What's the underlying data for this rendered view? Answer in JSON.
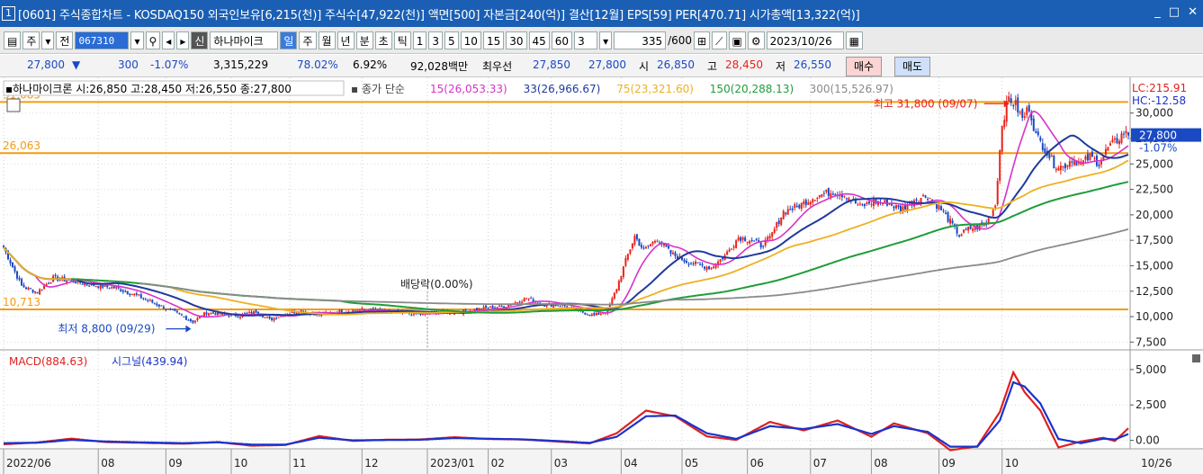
{
  "window": {
    "number": "1",
    "title": "[0601] 주식종합차트 - KOSDAQ150 외국인보유[6,215(천)] 주식수[47,922(천)] 액면[500] 자본금[240(억)] 결산[12월] EPS[59] PER[470.71] 시가총액[13,322(억)]",
    "controls": [
      "_",
      "□",
      "✕"
    ]
  },
  "toolbar": {
    "period_week": "주",
    "prefix": "전",
    "code": "067310",
    "badge": "신",
    "name": "하나마이크",
    "periods": [
      "일",
      "주",
      "월",
      "년",
      "분",
      "초",
      "틱"
    ],
    "active_period": "일",
    "intervals": [
      "1",
      "3",
      "5",
      "10",
      "15",
      "30",
      "45",
      "60"
    ],
    "count_select": "3",
    "bar_count": "335",
    "bar_total": "/600",
    "date": "2023/10/26"
  },
  "quote": {
    "price": "27,800",
    "arrow": "▼",
    "change": "300",
    "change_rate": "-1.07%",
    "volume": "3,315,229",
    "vol_ratio": "78.02%",
    "turnover": "6.92%",
    "amount": "92,028백만",
    "best_label": "최우선",
    "ask": "27,850",
    "bid": "27,800",
    "open_label": "시",
    "open": "26,850",
    "high_label": "고",
    "high": "28,450",
    "low_label": "저",
    "low": "26,550",
    "buy_label": "매수",
    "sell_label": "매도"
  },
  "colors": {
    "up": "#e8231b",
    "down": "#1a49c4",
    "hline": "#f39c12",
    "ma15": "#d633c8",
    "ma33": "#1f3a9e",
    "ma75": "#eeb021",
    "ma150": "#1f9d3a",
    "ma300": "#8a8a8a",
    "macd": "#e02020",
    "signal": "#1a33cc"
  },
  "chart_data": [
    {
      "type": "line",
      "subtype": "candlestick",
      "legend_stock": "하나마이크론 시:26,850 고:28,450 저:26,550 종:27,800",
      "legend_ma_prefix": "종가 단순",
      "series": [
        {
          "name": "15(26,053.33)",
          "period": 15
        },
        {
          "name": "33(26,966.67)",
          "period": 33
        },
        {
          "name": "75(23,321.60)",
          "period": 75
        },
        {
          "name": "150(20,288.13)",
          "period": 150
        },
        {
          "name": "300(15,526.97)",
          "period": 300
        }
      ],
      "close_anchors": [
        [
          0,
          16800
        ],
        [
          8,
          13000
        ],
        [
          15,
          12400
        ],
        [
          22,
          13800
        ],
        [
          30,
          13500
        ],
        [
          40,
          13100
        ],
        [
          50,
          12800
        ],
        [
          60,
          12000
        ],
        [
          68,
          11200
        ],
        [
          76,
          10400
        ],
        [
          84,
          9500
        ],
        [
          90,
          10400
        ],
        [
          98,
          10200
        ],
        [
          105,
          10100
        ],
        [
          112,
          10500
        ],
        [
          118,
          9700
        ],
        [
          124,
          10200
        ],
        [
          132,
          10600
        ],
        [
          140,
          10200
        ],
        [
          150,
          10500
        ],
        [
          160,
          10700
        ],
        [
          172,
          10500
        ],
        [
          180,
          10300
        ],
        [
          186,
          10200
        ],
        [
          194,
          10500
        ],
        [
          200,
          10400
        ],
        [
          206,
          10600
        ],
        [
          212,
          10800
        ],
        [
          222,
          11000
        ],
        [
          232,
          11800
        ],
        [
          240,
          11200
        ],
        [
          248,
          11100
        ],
        [
          256,
          10500
        ],
        [
          262,
          10100
        ],
        [
          268,
          10600
        ],
        [
          272,
          12800
        ],
        [
          276,
          15500
        ],
        [
          280,
          17900
        ],
        [
          284,
          16500
        ],
        [
          290,
          17700
        ],
        [
          296,
          16200
        ],
        [
          302,
          15500
        ],
        [
          308,
          15100
        ],
        [
          314,
          14800
        ],
        [
          320,
          16000
        ],
        [
          326,
          17800
        ],
        [
          332,
          17500
        ],
        [
          336,
          17000
        ],
        [
          340,
          17700
        ],
        [
          346,
          20300
        ],
        [
          352,
          20800
        ],
        [
          360,
          21800
        ],
        [
          368,
          22300
        ],
        [
          374,
          21900
        ],
        [
          380,
          20800
        ],
        [
          386,
          21300
        ],
        [
          392,
          21200
        ],
        [
          398,
          20500
        ],
        [
          404,
          21500
        ],
        [
          410,
          21900
        ],
        [
          416,
          20500
        ],
        [
          420,
          19300
        ],
        [
          424,
          18000
        ],
        [
          428,
          18600
        ],
        [
          432,
          18800
        ],
        [
          436,
          19100
        ],
        [
          440,
          21000
        ],
        [
          443,
          29000
        ],
        [
          446,
          31500
        ],
        [
          449,
          30800
        ],
        [
          452,
          29400
        ],
        [
          455,
          30600
        ],
        [
          458,
          27800
        ],
        [
          462,
          26500
        ],
        [
          466,
          25000
        ],
        [
          470,
          24700
        ],
        [
          474,
          25500
        ],
        [
          478,
          25000
        ],
        [
          482,
          25700
        ],
        [
          486,
          25100
        ],
        [
          490,
          26600
        ],
        [
          494,
          27300
        ],
        [
          497,
          28100
        ],
        [
          499,
          27800
        ]
      ],
      "markers": [
        {
          "label": "최고 31,800 (09/07)",
          "value": 31800,
          "bar": 447
        },
        {
          "label": "최저 8,800 (09/29)",
          "value": 8800,
          "bar": 84
        },
        {
          "label": "배당락(0.00%)",
          "bar": 196
        }
      ],
      "hlines": [
        {
          "label": "31,085",
          "value": 31085
        },
        {
          "label": "26,063",
          "value": 26063
        },
        {
          "label": "10,713",
          "value": 10713
        }
      ],
      "right_axis_labels": [
        "30,000",
        "27,500",
        "25,000",
        "22,500",
        "20,000",
        "17,500",
        "15,000",
        "12,500",
        "10,000",
        "7,500"
      ],
      "lc_label": "LC:215.91",
      "hc_label": "HC:-12.58",
      "price_tag": "27,800",
      "price_tag_rate": "-1.07%",
      "ylim": [
        7000,
        32800
      ],
      "bars": 500,
      "xlabel": "",
      "ylabel": ""
    },
    {
      "type": "line",
      "title": "",
      "legend": [
        "MACD(884.63)",
        "시그널(439.94)"
      ],
      "series": [
        {
          "name": "MACD(884.63)",
          "anchors": [
            [
              0,
              -280
            ],
            [
              15,
              -150
            ],
            [
              30,
              120
            ],
            [
              45,
              -120
            ],
            [
              60,
              -170
            ],
            [
              80,
              -240
            ],
            [
              95,
              -120
            ],
            [
              110,
              -380
            ],
            [
              125,
              -330
            ],
            [
              140,
              300
            ],
            [
              155,
              -40
            ],
            [
              170,
              40
            ],
            [
              185,
              60
            ],
            [
              200,
              220
            ],
            [
              215,
              100
            ],
            [
              230,
              60
            ],
            [
              245,
              -80
            ],
            [
              260,
              -220
            ],
            [
              272,
              500
            ],
            [
              285,
              2100
            ],
            [
              298,
              1700
            ],
            [
              312,
              280
            ],
            [
              325,
              30
            ],
            [
              340,
              1300
            ],
            [
              355,
              700
            ],
            [
              370,
              1400
            ],
            [
              385,
              250
            ],
            [
              395,
              1200
            ],
            [
              410,
              500
            ],
            [
              420,
              -700
            ],
            [
              432,
              -420
            ],
            [
              442,
              2000
            ],
            [
              448,
              4800
            ],
            [
              453,
              3400
            ],
            [
              460,
              2100
            ],
            [
              468,
              -500
            ],
            [
              478,
              -80
            ],
            [
              488,
              180
            ],
            [
              493,
              -50
            ],
            [
              499,
              850
            ]
          ]
        },
        {
          "name": "시그널(439.94)",
          "anchors": [
            [
              0,
              -200
            ],
            [
              15,
              -170
            ],
            [
              30,
              30
            ],
            [
              45,
              -80
            ],
            [
              60,
              -140
            ],
            [
              80,
              -200
            ],
            [
              95,
              -140
            ],
            [
              110,
              -300
            ],
            [
              125,
              -300
            ],
            [
              140,
              180
            ],
            [
              155,
              0
            ],
            [
              170,
              20
            ],
            [
              185,
              40
            ],
            [
              200,
              160
            ],
            [
              215,
              110
            ],
            [
              230,
              70
            ],
            [
              245,
              -40
            ],
            [
              260,
              -180
            ],
            [
              272,
              250
            ],
            [
              285,
              1700
            ],
            [
              298,
              1750
            ],
            [
              312,
              500
            ],
            [
              325,
              100
            ],
            [
              340,
              1000
            ],
            [
              355,
              800
            ],
            [
              370,
              1150
            ],
            [
              385,
              450
            ],
            [
              395,
              1000
            ],
            [
              410,
              600
            ],
            [
              420,
              -450
            ],
            [
              432,
              -450
            ],
            [
              442,
              1400
            ],
            [
              448,
              4100
            ],
            [
              453,
              3800
            ],
            [
              460,
              2600
            ],
            [
              468,
              100
            ],
            [
              478,
              -200
            ],
            [
              488,
              120
            ],
            [
              493,
              60
            ],
            [
              499,
              440
            ]
          ]
        }
      ],
      "right_axis_labels": [
        "5,000",
        "2,500",
        "0.00"
      ],
      "ylim": [
        -600,
        6200
      ]
    }
  ],
  "x_axis": {
    "labels": [
      {
        "text": "2022/06",
        "bar": 0
      },
      {
        "text": "08",
        "bar": 42
      },
      {
        "text": "09",
        "bar": 72
      },
      {
        "text": "10",
        "bar": 101
      },
      {
        "text": "11",
        "bar": 127
      },
      {
        "text": "12",
        "bar": 159
      },
      {
        "text": "2023/01",
        "bar": 188
      },
      {
        "text": "02",
        "bar": 215
      },
      {
        "text": "03",
        "bar": 243
      },
      {
        "text": "04",
        "bar": 274
      },
      {
        "text": "05",
        "bar": 301
      },
      {
        "text": "06",
        "bar": 330
      },
      {
        "text": "07",
        "bar": 358
      },
      {
        "text": "08",
        "bar": 385
      },
      {
        "text": "09",
        "bar": 415
      },
      {
        "text": "10",
        "bar": 443
      }
    ],
    "end_label": "10/26"
  }
}
